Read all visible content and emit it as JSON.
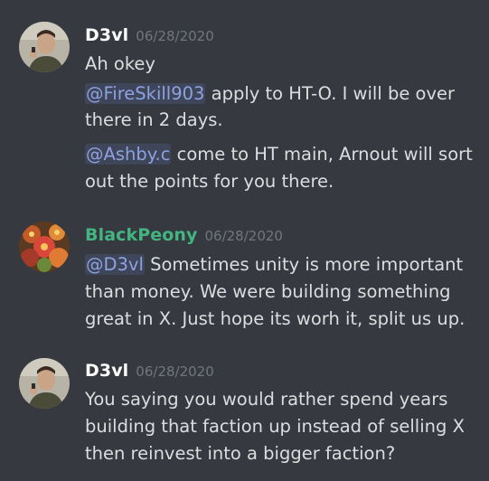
{
  "messages": [
    {
      "author": "D3vl",
      "timestamp": "06/28/2020",
      "author_color": "#ffffff",
      "avatar": "man-portrait-avatar",
      "lines": [
        {
          "text": "Ah okey"
        },
        {
          "mention": "@FireSkill903",
          "text": " apply to HT-O. I will be over",
          "text2": "there in 2 days."
        },
        {
          "mention": "@Ashby.c",
          "text": " come to HT main, Arnout will sort",
          "text2": "out the points for you there."
        }
      ]
    },
    {
      "author": "BlackPeony",
      "timestamp": "06/28/2020",
      "author_color": "#43b581",
      "avatar": "flower-avatar",
      "lines": [
        {
          "mention": "@D3vl",
          "text": " Sometimes unity is more important",
          "text2": "than money. We were building something",
          "text3": "great in X. Just hope its worh it, split us up."
        }
      ]
    },
    {
      "author": "D3vl",
      "timestamp": "06/28/2020",
      "author_color": "#ffffff",
      "avatar": "man-portrait-avatar",
      "lines": [
        {
          "text": "You saying you would rather spend years",
          "text2": "building that faction up instead of selling X",
          "text3": "then reinvest into a bigger faction?"
        }
      ]
    }
  ],
  "colors": {
    "background": "#36393f",
    "text": "#dcddde",
    "timestamp": "#72767d",
    "mention_text": "#8ea1e1",
    "green_role": "#43b581"
  }
}
